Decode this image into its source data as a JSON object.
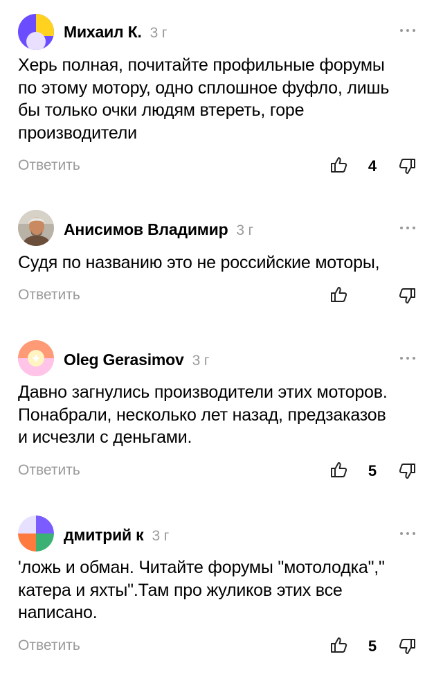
{
  "comments": [
    {
      "author": "Михаил К.",
      "time": "3 г",
      "text": "Херь полная, почитайте профильные форумы\nпо этому мотору, одно сплошное фуфло, лишь\nбы только очки людям втереть, горе\nпроизводители",
      "reply": "Ответить",
      "likes": "4",
      "avatar": "abstract-yellow-purple"
    },
    {
      "author": "Анисимов Владимир",
      "time": "3 г",
      "text": "Судя по названию это не российские моторы,",
      "reply": "Ответить",
      "likes": "",
      "avatar": "photo"
    },
    {
      "author": "Oleg Gerasimov",
      "time": "3 г",
      "text": "Давно загнулись производители этих моторов.\nПонабрали, несколько лет назад, предзаказов\nи исчезли с деньгами.",
      "reply": "Ответить",
      "likes": "5",
      "avatar": "abstract-orange-pink"
    },
    {
      "author": "дмитрий к",
      "time": "3 г",
      "text": "'ложь и обман. Читайте форумы \"мотолодка\",\"\nкатера и яхты\".Там про жуликов этих все\nнаписано.",
      "reply": "Ответить",
      "likes": "5",
      "avatar": "abstract-purple-orange-green"
    }
  ]
}
